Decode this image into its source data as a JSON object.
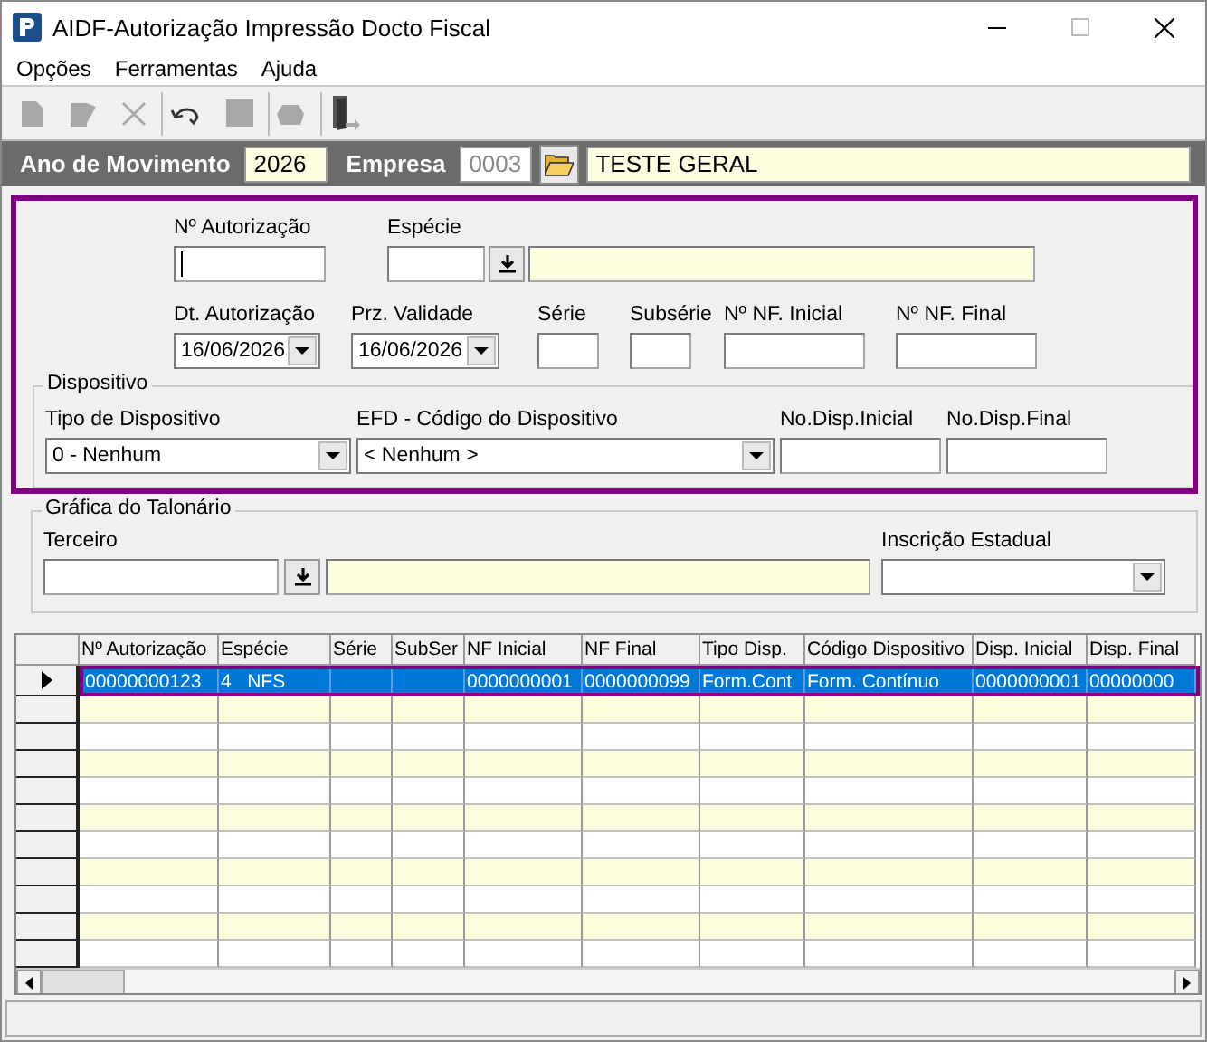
{
  "window": {
    "title": "AIDF-Autorização Impressão Docto Fiscal"
  },
  "window_controls": [
    {
      "kind": "minimize",
      "disabled": false
    },
    {
      "kind": "maximize",
      "disabled": true
    },
    {
      "kind": "close",
      "disabled": false
    }
  ],
  "menu": [
    "Opções",
    "Ferramentas",
    "Ajuda"
  ],
  "toolbar": [
    [
      {
        "kind": "new",
        "disabled": true
      },
      {
        "kind": "edit",
        "disabled": true
      },
      {
        "kind": "delete",
        "disabled": true
      }
    ],
    [
      {
        "kind": "undo",
        "disabled": false
      },
      {
        "kind": "stop",
        "disabled": true
      }
    ],
    [
      {
        "kind": "print",
        "disabled": true
      }
    ],
    [
      {
        "kind": "exit",
        "disabled": false
      }
    ]
  ],
  "header": {
    "year_label": "Ano de Movimento",
    "year": "2026",
    "company_label": "Empresa",
    "company_code": "0003",
    "company_code_disabled": true,
    "company_name": "TESTE GERAL"
  },
  "authorization": {
    "nr_autorizacao": {
      "label": "Nº Autorização",
      "focused": true
    },
    "especie": {
      "label": "Espécie"
    },
    "dt_autorizacao": {
      "label": "Dt. Autorização",
      "value": "16/06/2026"
    },
    "prz_validade": {
      "label": "Prz. Validade",
      "value": "16/06/2026"
    },
    "serie": {
      "label": "Série"
    },
    "subserie": {
      "label": "Subsérie"
    },
    "nf_inicial": {
      "label": "Nº NF. Inicial"
    },
    "nf_final": {
      "label": "Nº NF. Final"
    }
  },
  "dispositivo": {
    "title": "Dispositivo",
    "tipo": {
      "label": "Tipo de Dispositivo",
      "value": "0 - Nenhum"
    },
    "efd": {
      "label": "EFD - Código do Dispositivo",
      "value": "< Nenhum >"
    },
    "disp_inicial": {
      "label": "No.Disp.Inicial"
    },
    "disp_final": {
      "label": "No.Disp.Final"
    }
  },
  "grafica": {
    "title": "Gráfica do Talonário",
    "terceiro": {
      "label": "Terceiro"
    },
    "inscricao": {
      "label": "Inscrição Estadual"
    }
  },
  "table": {
    "columns": [
      "Nº Autorização",
      "Espécie",
      "Série",
      "SubSer",
      "NF Inicial",
      "NF Final",
      "Tipo Disp.",
      "Código Dispositivo",
      "Disp. Inicial",
      "Disp. Final"
    ],
    "rows": [
      {
        "selected": true,
        "cells": [
          "00000000123",
          "4   NFS",
          null,
          null,
          "0000000001",
          "0000000099",
          "Form.Cont",
          "Form. Contínuo",
          "0000000001",
          "00000000"
        ]
      }
    ]
  }
}
